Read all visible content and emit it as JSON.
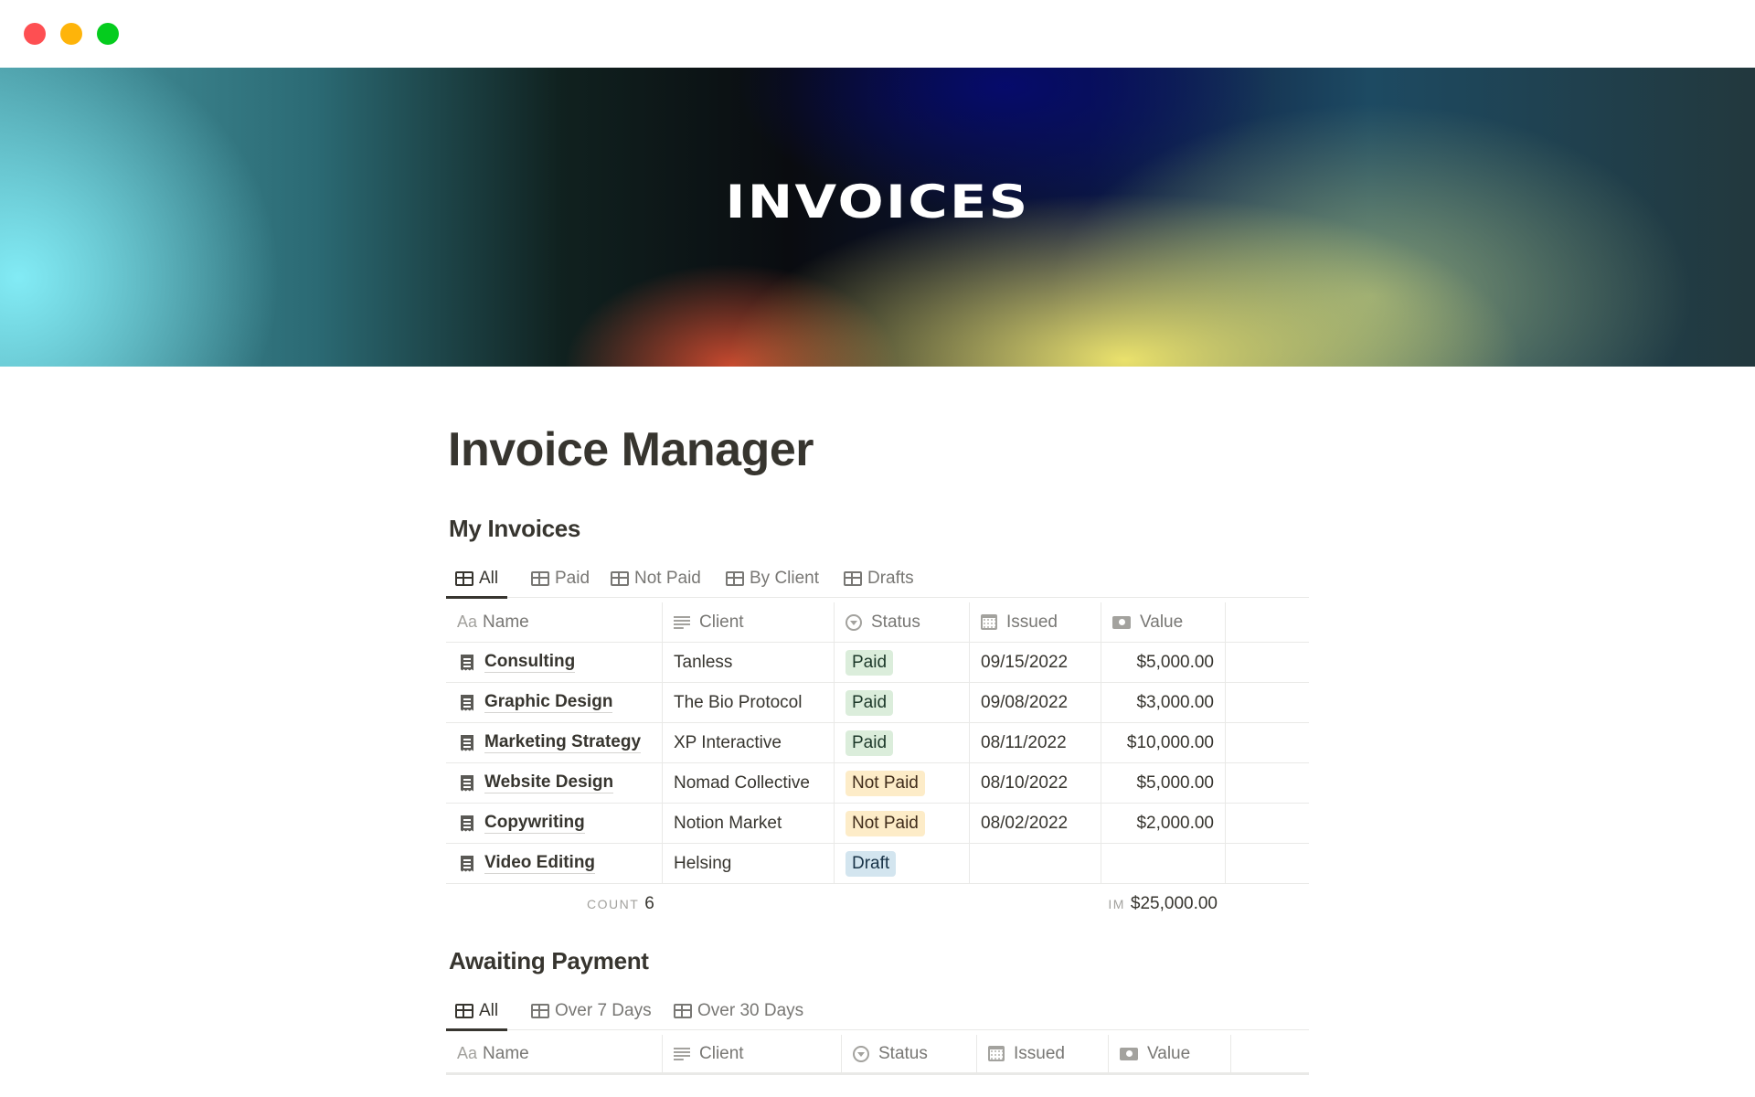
{
  "window": {
    "controls": [
      "close",
      "minimize",
      "maximize"
    ]
  },
  "banner": {
    "title": "INVOICES"
  },
  "page": {
    "title": "Invoice Manager"
  },
  "my_invoices": {
    "title": "My Invoices",
    "tabs": [
      {
        "label": "All",
        "active": true,
        "icon": "table-icon"
      },
      {
        "label": "Paid",
        "active": false,
        "icon": "table-icon"
      },
      {
        "label": "Not Paid",
        "active": false,
        "icon": "table-icon"
      },
      {
        "label": "By Client",
        "active": false,
        "icon": "table-icon"
      },
      {
        "label": "Drafts",
        "active": false,
        "icon": "table-icon"
      }
    ],
    "columns": [
      {
        "label": "Name",
        "icon": "Aa"
      },
      {
        "label": "Client",
        "icon": "text-lines-icon"
      },
      {
        "label": "Status",
        "icon": "status-select-icon"
      },
      {
        "label": "Issued",
        "icon": "calendar-icon"
      },
      {
        "label": "Value",
        "icon": "money-icon"
      }
    ],
    "rows": [
      {
        "name": "Consulting",
        "client": "Tanless",
        "status": "Paid",
        "issued": "09/15/2022",
        "value": "$5,000.00"
      },
      {
        "name": "Graphic Design",
        "client": "The Bio Protocol",
        "status": "Paid",
        "issued": "09/08/2022",
        "value": "$3,000.00"
      },
      {
        "name": "Marketing Strategy",
        "client": "XP Interactive",
        "status": "Paid",
        "issued": "08/11/2022",
        "value": "$10,000.00"
      },
      {
        "name": "Website Design",
        "client": "Nomad Collective",
        "status": "Not Paid",
        "issued": "08/10/2022",
        "value": "$5,000.00"
      },
      {
        "name": "Copywriting",
        "client": "Notion Market",
        "status": "Not Paid",
        "issued": "08/02/2022",
        "value": "$2,000.00"
      },
      {
        "name": "Video Editing",
        "client": "Helsing",
        "status": "Draft",
        "issued": "",
        "value": ""
      }
    ],
    "footer": {
      "count_label": "COUNT",
      "count_value": "6",
      "sum_label": "IM",
      "sum_value": "$25,000.00"
    }
  },
  "awaiting_payment": {
    "title": "Awaiting Payment",
    "tabs": [
      {
        "label": "All",
        "active": true,
        "icon": "table-icon"
      },
      {
        "label": "Over 7 Days",
        "active": false,
        "icon": "table-icon"
      },
      {
        "label": "Over 30 Days",
        "active": false,
        "icon": "table-icon"
      }
    ],
    "columns": [
      {
        "label": "Name",
        "icon": "Aa"
      },
      {
        "label": "Client",
        "icon": "text-lines-icon"
      },
      {
        "label": "Status",
        "icon": "status-select-icon"
      },
      {
        "label": "Issued",
        "icon": "calendar-icon"
      },
      {
        "label": "Value",
        "icon": "money-icon"
      }
    ]
  },
  "status_colors": {
    "Paid": {
      "bg": "#dbeddb",
      "fg": "#1c3829"
    },
    "Not Paid": {
      "bg": "#fdecc8",
      "fg": "#402c1b"
    },
    "Draft": {
      "bg": "#d3e5ef",
      "fg": "#183347"
    }
  }
}
